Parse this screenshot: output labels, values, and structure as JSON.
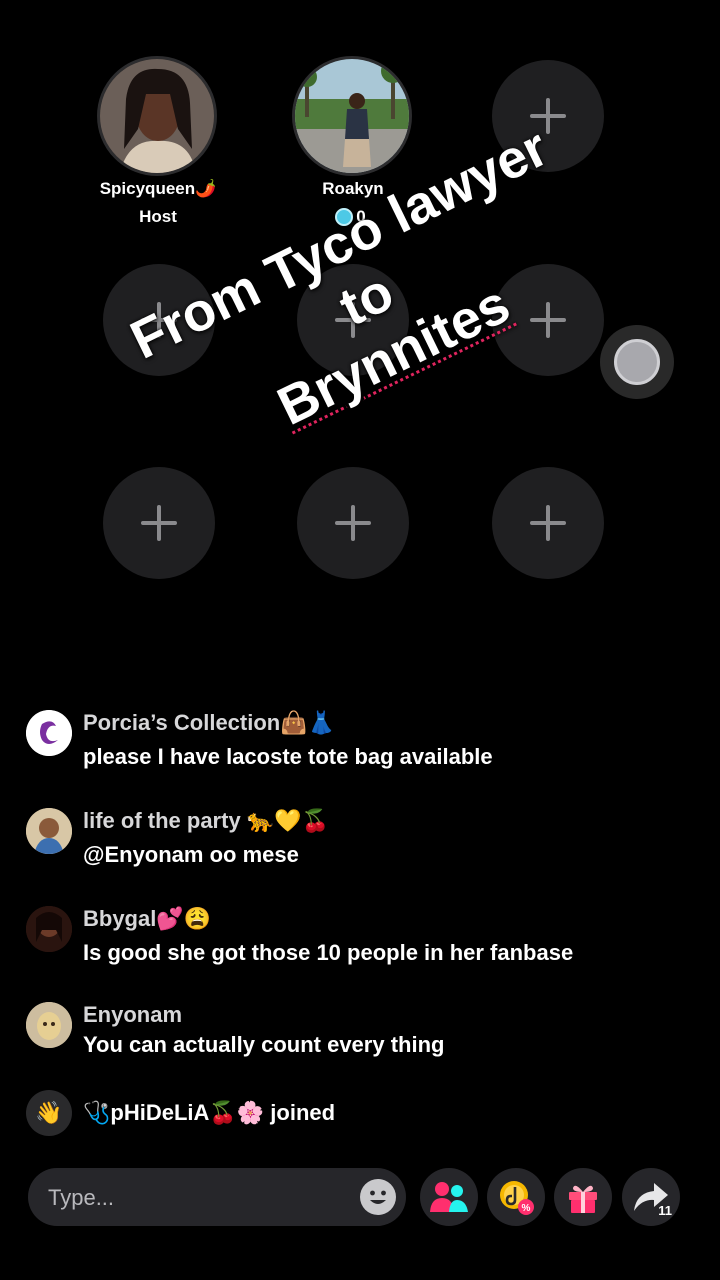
{
  "stage": {
    "host": {
      "name": "Spicyqueen🌶️",
      "role": "Host"
    },
    "guest": {
      "name": "Roakyn",
      "count": "0"
    },
    "empty_slot_icon": "plus-icon"
  },
  "overlay": {
    "caption_line1": "From Tyco lawyer to",
    "caption_line2": "Brynnites"
  },
  "comments": [
    {
      "user": "Porcia’s Collection👜👗",
      "text": "please I have lacoste tote bag available"
    },
    {
      "user": "life of the party 🐆💛🍒",
      "text": "@Enyonam oo mese"
    },
    {
      "user": "Bbygal💕😩",
      "text": "Is good she got those 10 people in her fanbase"
    },
    {
      "user": "Enyonam",
      "text": "You can actually count every thing"
    }
  ],
  "join_message": "🩺pHiDeLiA🍒🌸 joined",
  "input": {
    "placeholder": "Type..."
  },
  "actions": {
    "share_count": "11"
  },
  "colors": {
    "accent_pink": "#ff2f6e",
    "accent_teal": "#25f4ee",
    "coin_gold": "#f5b700"
  }
}
